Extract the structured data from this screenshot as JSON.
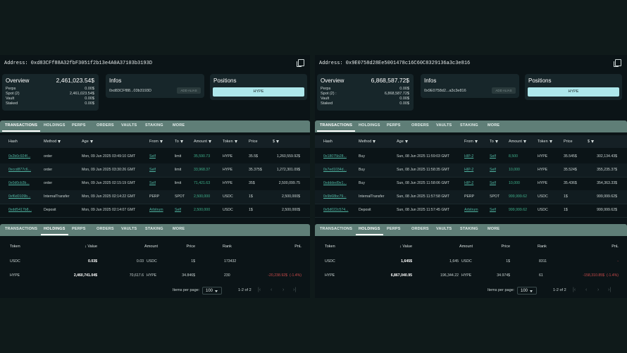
{
  "left": {
    "address": "Address: 0xd83CFf88A32fbF3051f2b13e4A0A37103b3193D",
    "overview": {
      "title": "Overview",
      "total": "2,461,023.54$",
      "rows": [
        {
          "label": "Perps",
          "value": "0.00$"
        },
        {
          "label": "Spot (2)",
          "value": "2,461,023.54$"
        },
        {
          "label": "Vault",
          "value": "0.00$"
        },
        {
          "label": "Staked",
          "value": "0.00$"
        }
      ]
    },
    "infos": {
      "title": "Infos",
      "short_address": "0xd83CFf88...03b3193D",
      "alias_button": "ADD ALIAS"
    },
    "positions": {
      "title": "Positions",
      "button": "HYPE"
    },
    "tabs": [
      "TRANSACTIONS",
      "HOLDINGS",
      "PERPS",
      "ORDERS",
      "VAULTS",
      "STAKING",
      "MORE"
    ],
    "tx_headers": [
      "Hash",
      "Method",
      "Age",
      "From",
      "To",
      "Amount",
      "Token",
      "Price",
      "$"
    ],
    "transactions": [
      {
        "hash": "0x2b0c924f...",
        "method": "order",
        "age": "Mon, 09 Jun 2025 03:49:10 GMT",
        "from": "Self",
        "to": "limit",
        "amount": "35,590.73",
        "token": "HYPE",
        "price": "35.5$",
        "usd": "1,260,559.92$"
      },
      {
        "hash": "0xccd877c6...",
        "method": "order",
        "age": "Mon, 09 Jun 2025 03:30:26 GMT",
        "from": "Self",
        "to": "limit",
        "amount": "33,968.37",
        "token": "HYPE",
        "price": "35.375$",
        "usd": "1,272,301.09$"
      },
      {
        "hash": "0x0d0cb3b...",
        "method": "order",
        "age": "Mon, 09 Jun 2025 02:15:19 GMT",
        "from": "Self",
        "to": "limit",
        "amount": "71,421.63",
        "token": "HYPE",
        "price": "35$",
        "usd": "2,500,099.75"
      },
      {
        "hash": "0xf6d0109b...",
        "method": "InternalTransfer",
        "age": "Mon, 09 Jun 2025 02:14:22 GMT",
        "from": "PERP",
        "to": "SPOT",
        "amount": "2,500,000",
        "token": "USDC",
        "price": "1$",
        "usd": "2,500,000$"
      },
      {
        "hash": "0xdd5417b8...",
        "method": "Deposit",
        "age": "Mon, 09 Jun 2025 02:14:07 GMT",
        "from": "Arbitrum",
        "to": "Self",
        "amount": "2,500,000",
        "token": "USDC",
        "price": "1$",
        "usd": "2,500,000$"
      }
    ],
    "tabs2": [
      "TRANSACTIONS",
      "HOLDINGS",
      "PERPS",
      "ORDERS",
      "VAULTS",
      "STAKING",
      "MORE"
    ],
    "hold_headers": [
      "Token",
      "↓ Value",
      "Amount",
      "Price",
      "Rank",
      "PnL"
    ],
    "holdings": [
      {
        "token": "USDC",
        "value": "0.03$",
        "amount": "0.03",
        "amount_token": "USDC",
        "price": "1$",
        "rank": "173432",
        "pnl": ""
      },
      {
        "token": "HYPE",
        "value": "2,460,741.04$",
        "amount": "70,617.6",
        "amount_token": "HYPE",
        "price": "34.846$",
        "rank": "230",
        "pnl": "-20,238.92$",
        "pnl_pct": "(-1.4%)"
      }
    ],
    "pager": {
      "label": "Items per page:",
      "size": "100",
      "range": "1-2 of 2"
    }
  },
  "right": {
    "address": "Address: 0x9E0758d28Ee5001478c16C60C8329136a3c3e816",
    "overview": {
      "title": "Overview",
      "total": "6,868,587.72$",
      "rows": [
        {
          "label": "Perps",
          "value": "0.00$"
        },
        {
          "label": "Spot (2) :",
          "value": "6,868,587.72$"
        },
        {
          "label": "Vault",
          "value": "0.00$"
        },
        {
          "label": "Staked",
          "value": "0.00$"
        }
      ]
    },
    "infos": {
      "title": "Infos",
      "short_address": "0x9E0758d2...a3c3e816",
      "alias_button": "ADD ALIAS"
    },
    "positions": {
      "title": "Positions",
      "button": "HYPE"
    },
    "tabs": [
      "TRANSACTIONS",
      "HOLDINGS",
      "PERPS",
      "ORDERS",
      "VAULTS",
      "STAKING",
      "MORE"
    ],
    "tx_headers": [
      "Hash",
      "Method",
      "Age",
      "From",
      "To",
      "Amount",
      "Token",
      "Price",
      "$"
    ],
    "transactions": [
      {
        "hash": "0x18075b28...",
        "method": "Buy",
        "age": "Sun, 08 Jun 2025 11:59:03 GMT",
        "from": "HIP-2",
        "to": "Self",
        "amount": "8,500",
        "token": "HYPE",
        "price": "35.545$",
        "usd": "302,134.43$"
      },
      {
        "hash": "0x7ed1034d...",
        "method": "Buy",
        "age": "Sun, 08 Jun 2025 11:58:35 GMT",
        "from": "HIP-2",
        "to": "Self",
        "amount": "10,000",
        "token": "HYPE",
        "price": "35.524$",
        "usd": "355,235.37$"
      },
      {
        "hash": "0xddded9e1...",
        "method": "Buy",
        "age": "Sun, 08 Jun 2025 11:58:06 GMT",
        "from": "HIP-2",
        "to": "Self",
        "amount": "10,000",
        "token": "HYPE",
        "price": "35.436$",
        "usd": "354,363.33$"
      },
      {
        "hash": "0x9b68bc79...",
        "method": "InternalTransfer",
        "age": "Sun, 08 Jun 2025 11:57:58 GMT",
        "from": "PERP",
        "to": "SPOT",
        "amount": "999,999.62",
        "token": "USDC",
        "price": "1$",
        "usd": "999,999.62$"
      },
      {
        "hash": "0x5d022c574...",
        "method": "Deposit",
        "age": "Sun, 08 Jun 2025 11:57:45 GMT",
        "from": "Arbitrum",
        "to": "Self",
        "amount": "999,999.62",
        "token": "USDC",
        "price": "1$",
        "usd": "999,999.62$"
      }
    ],
    "tabs2": [
      "TRANSACTIONS",
      "HOLDINGS",
      "PERPS",
      "ORDERS",
      "VAULTS",
      "STAKING",
      "MORE"
    ],
    "hold_headers": [
      "Token",
      "↓ Value",
      "Amount",
      "Price",
      "Rank",
      "PnL"
    ],
    "holdings": [
      {
        "token": "USDC",
        "value": "1,645$",
        "amount": "1,645",
        "amount_token": "USDC",
        "price": "1$",
        "rank": "8311",
        "pnl": "-"
      },
      {
        "token": "HYPE",
        "value": "6,867,040.95",
        "amount": "196,344.22",
        "amount_token": "HYPE",
        "price": "34.974$",
        "rank": "61",
        "pnl": "-158,310.85$",
        "pnl_pct": "(-1.4%)"
      }
    ],
    "pager": {
      "label": "Items per page:",
      "size": "100",
      "range": "1-2 of 2"
    }
  }
}
